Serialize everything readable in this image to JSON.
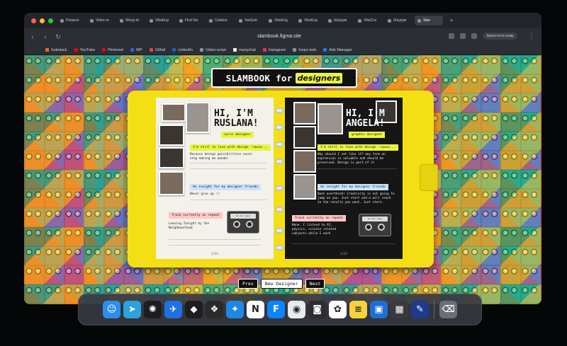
{
  "browser": {
    "tabs": [
      {
        "label": "Porpuse"
      },
      {
        "label": "Video ec"
      },
      {
        "label": "Wong dc"
      },
      {
        "label": "VibeEng"
      },
      {
        "label": "Find Ver"
      },
      {
        "label": "Celebra"
      },
      {
        "label": "VanGob"
      },
      {
        "label": "VibeEng"
      },
      {
        "label": "VibeEng"
      },
      {
        "label": "Шоурум"
      },
      {
        "label": "VibeCra"
      },
      {
        "label": "Шоурум"
      },
      {
        "label": "Slan"
      }
    ],
    "active_tab_index": 12,
    "url": "slambook.figma.site",
    "relaunch_label": "Запустити нову"
  },
  "bookmarks": [
    {
      "label": "Substack",
      "color": "#ff6719"
    },
    {
      "label": "YouTube",
      "color": "#ff0000"
    },
    {
      "label": "Pinterest",
      "color": "#e60023"
    },
    {
      "label": "WP",
      "color": "#3858e9"
    },
    {
      "label": "GMail",
      "color": "#ea4335"
    },
    {
      "label": "LinkedIn",
      "color": "#0a66c2"
    },
    {
      "label": "Video-script",
      "color": "#8a8f99"
    },
    {
      "label": "manychat",
      "color": "#ffffff"
    },
    {
      "label": "Instagram",
      "color": "#e1306c"
    },
    {
      "label": "Inspo web",
      "color": "#8a8f99"
    },
    {
      "label": "Ads Manager",
      "color": "#1877f2"
    }
  ],
  "site": {
    "title_main": "SLAMBOOK for",
    "title_accent": "designers",
    "left_page": {
      "hello": "HI, I'M",
      "name": "RUSLANA!",
      "role": "ux/ui designer",
      "prompt1": "I'm still in love with design 'cause...",
      "answer1": "Because design possibilities never stop making me wonder",
      "prompt2": "An insight for my designer friends",
      "answer2": "Never give up :)",
      "prompt3": "Track currently on repeat",
      "answer3": "Leaving Tonight by the Neighbourhood",
      "page_number": "2/23"
    },
    "right_page": {
      "hello": "HI, I'M",
      "name": "ANGELA!",
      "role": "graphic designer",
      "prompt1": "I'm still in love with design 'cause...",
      "answer1": "Why should I not like it? any form an expression is valuable and should be preserved. Design is part of it",
      "prompt2": "An insight for my designer friends",
      "answer2": "Dont overthink! Creativity is not going to jump on you. Just start and a will reach to the results you want. Just start.",
      "prompt3": "Track currently on repeat",
      "answer3": "None. I listend to AI, physics, science related subjects while I work",
      "page_number": "3/23"
    },
    "nav": {
      "prev": "Prev",
      "new_designer": "New Designer",
      "next": "Next"
    },
    "cassette_label": "my mix tape"
  },
  "dock": {
    "apps": [
      {
        "name": "finder-icon",
        "color": "#2d8cf0",
        "glyph": "☺"
      },
      {
        "name": "telegram-icon",
        "color": "#2aa3df",
        "glyph": "➤"
      },
      {
        "name": "perplexity-icon",
        "color": "#1d1d1f",
        "glyph": "✺"
      },
      {
        "name": "testflight-icon",
        "color": "#1f6fe5",
        "glyph": "✈"
      },
      {
        "name": "figma-app-icon",
        "color": "#1e1e1e",
        "glyph": "◆"
      },
      {
        "name": "figma-icon",
        "color": "#2b2b2b",
        "glyph": "❖"
      },
      {
        "name": "safari-icon",
        "color": "#1e88e5",
        "glyph": "✦"
      },
      {
        "name": "notion-icon",
        "color": "#ffffff",
        "glyph": "N"
      },
      {
        "name": "framer-icon",
        "color": "#0a84ff",
        "glyph": "F"
      },
      {
        "name": "chrome-icon",
        "color": "#e8eaed",
        "glyph": "◉"
      },
      {
        "name": "screenshot-icon",
        "color": "#2e2e30",
        "glyph": "◙"
      },
      {
        "name": "photos-icon",
        "color": "#ffffff",
        "glyph": "✿"
      },
      {
        "name": "notes-icon",
        "color": "#f7d33b",
        "glyph": "≡"
      },
      {
        "name": "files-icon",
        "color": "#1d6fd6",
        "glyph": "▣"
      },
      {
        "name": "calculator-icon",
        "color": "#3a3a3c",
        "glyph": "▦"
      },
      {
        "name": "pencil-icon",
        "color": "#1e3a8a",
        "glyph": "✎"
      },
      {
        "name": "trash-icon",
        "color": "#6b6e75",
        "glyph": "⌫"
      }
    ]
  },
  "colors": {
    "binder": "#f4df14",
    "highlight_lime": "#e9f542",
    "highlight_blue": "#c9e3ff",
    "highlight_pink": "#ffc7c7"
  }
}
